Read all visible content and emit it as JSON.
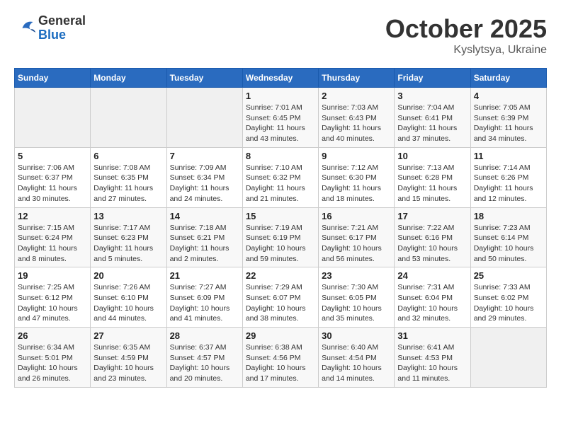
{
  "header": {
    "logo_general": "General",
    "logo_blue": "Blue",
    "month": "October 2025",
    "location": "Kyslytsya, Ukraine"
  },
  "weekdays": [
    "Sunday",
    "Monday",
    "Tuesday",
    "Wednesday",
    "Thursday",
    "Friday",
    "Saturday"
  ],
  "weeks": [
    [
      {
        "day": "",
        "info": ""
      },
      {
        "day": "",
        "info": ""
      },
      {
        "day": "",
        "info": ""
      },
      {
        "day": "1",
        "info": "Sunrise: 7:01 AM\nSunset: 6:45 PM\nDaylight: 11 hours and 43 minutes."
      },
      {
        "day": "2",
        "info": "Sunrise: 7:03 AM\nSunset: 6:43 PM\nDaylight: 11 hours and 40 minutes."
      },
      {
        "day": "3",
        "info": "Sunrise: 7:04 AM\nSunset: 6:41 PM\nDaylight: 11 hours and 37 minutes."
      },
      {
        "day": "4",
        "info": "Sunrise: 7:05 AM\nSunset: 6:39 PM\nDaylight: 11 hours and 34 minutes."
      }
    ],
    [
      {
        "day": "5",
        "info": "Sunrise: 7:06 AM\nSunset: 6:37 PM\nDaylight: 11 hours and 30 minutes."
      },
      {
        "day": "6",
        "info": "Sunrise: 7:08 AM\nSunset: 6:35 PM\nDaylight: 11 hours and 27 minutes."
      },
      {
        "day": "7",
        "info": "Sunrise: 7:09 AM\nSunset: 6:34 PM\nDaylight: 11 hours and 24 minutes."
      },
      {
        "day": "8",
        "info": "Sunrise: 7:10 AM\nSunset: 6:32 PM\nDaylight: 11 hours and 21 minutes."
      },
      {
        "day": "9",
        "info": "Sunrise: 7:12 AM\nSunset: 6:30 PM\nDaylight: 11 hours and 18 minutes."
      },
      {
        "day": "10",
        "info": "Sunrise: 7:13 AM\nSunset: 6:28 PM\nDaylight: 11 hours and 15 minutes."
      },
      {
        "day": "11",
        "info": "Sunrise: 7:14 AM\nSunset: 6:26 PM\nDaylight: 11 hours and 12 minutes."
      }
    ],
    [
      {
        "day": "12",
        "info": "Sunrise: 7:15 AM\nSunset: 6:24 PM\nDaylight: 11 hours and 8 minutes."
      },
      {
        "day": "13",
        "info": "Sunrise: 7:17 AM\nSunset: 6:23 PM\nDaylight: 11 hours and 5 minutes."
      },
      {
        "day": "14",
        "info": "Sunrise: 7:18 AM\nSunset: 6:21 PM\nDaylight: 11 hours and 2 minutes."
      },
      {
        "day": "15",
        "info": "Sunrise: 7:19 AM\nSunset: 6:19 PM\nDaylight: 10 hours and 59 minutes."
      },
      {
        "day": "16",
        "info": "Sunrise: 7:21 AM\nSunset: 6:17 PM\nDaylight: 10 hours and 56 minutes."
      },
      {
        "day": "17",
        "info": "Sunrise: 7:22 AM\nSunset: 6:16 PM\nDaylight: 10 hours and 53 minutes."
      },
      {
        "day": "18",
        "info": "Sunrise: 7:23 AM\nSunset: 6:14 PM\nDaylight: 10 hours and 50 minutes."
      }
    ],
    [
      {
        "day": "19",
        "info": "Sunrise: 7:25 AM\nSunset: 6:12 PM\nDaylight: 10 hours and 47 minutes."
      },
      {
        "day": "20",
        "info": "Sunrise: 7:26 AM\nSunset: 6:10 PM\nDaylight: 10 hours and 44 minutes."
      },
      {
        "day": "21",
        "info": "Sunrise: 7:27 AM\nSunset: 6:09 PM\nDaylight: 10 hours and 41 minutes."
      },
      {
        "day": "22",
        "info": "Sunrise: 7:29 AM\nSunset: 6:07 PM\nDaylight: 10 hours and 38 minutes."
      },
      {
        "day": "23",
        "info": "Sunrise: 7:30 AM\nSunset: 6:05 PM\nDaylight: 10 hours and 35 minutes."
      },
      {
        "day": "24",
        "info": "Sunrise: 7:31 AM\nSunset: 6:04 PM\nDaylight: 10 hours and 32 minutes."
      },
      {
        "day": "25",
        "info": "Sunrise: 7:33 AM\nSunset: 6:02 PM\nDaylight: 10 hours and 29 minutes."
      }
    ],
    [
      {
        "day": "26",
        "info": "Sunrise: 6:34 AM\nSunset: 5:01 PM\nDaylight: 10 hours and 26 minutes."
      },
      {
        "day": "27",
        "info": "Sunrise: 6:35 AM\nSunset: 4:59 PM\nDaylight: 10 hours and 23 minutes."
      },
      {
        "day": "28",
        "info": "Sunrise: 6:37 AM\nSunset: 4:57 PM\nDaylight: 10 hours and 20 minutes."
      },
      {
        "day": "29",
        "info": "Sunrise: 6:38 AM\nSunset: 4:56 PM\nDaylight: 10 hours and 17 minutes."
      },
      {
        "day": "30",
        "info": "Sunrise: 6:40 AM\nSunset: 4:54 PM\nDaylight: 10 hours and 14 minutes."
      },
      {
        "day": "31",
        "info": "Sunrise: 6:41 AM\nSunset: 4:53 PM\nDaylight: 10 hours and 11 minutes."
      },
      {
        "day": "",
        "info": ""
      }
    ]
  ]
}
